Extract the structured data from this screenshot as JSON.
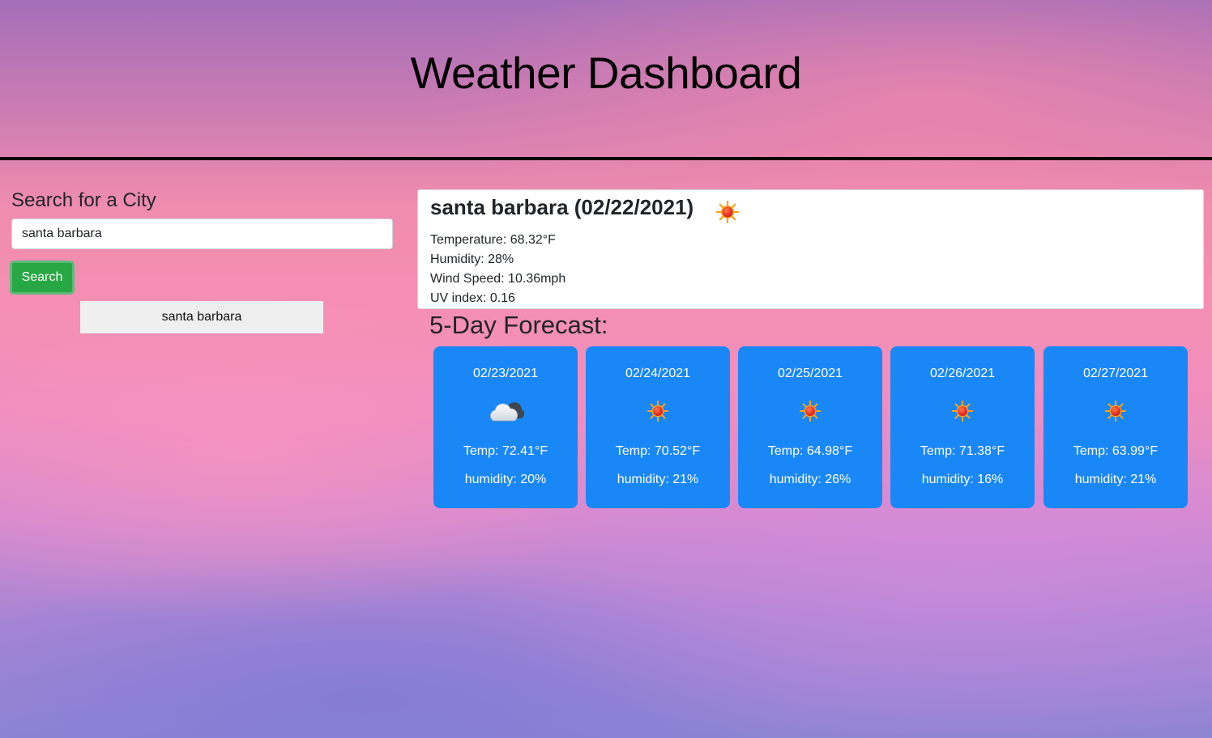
{
  "header": {
    "title": "Weather Dashboard"
  },
  "search": {
    "heading": "Search for a City",
    "input_value": "santa barbara",
    "button_label": "Search",
    "history": [
      "santa barbara"
    ]
  },
  "current": {
    "title": "santa barbara (02/22/2021)",
    "icon": "sun-icon",
    "temperature": "Temperature: 68.32°F",
    "humidity": "Humidity: 28%",
    "wind": "Wind Speed: 10.36mph",
    "uv": "UV index: 0.16"
  },
  "forecast": {
    "heading": "5-Day Forecast:",
    "days": [
      {
        "date": "02/23/2021",
        "icon": "cloud-icon",
        "temp": "Temp: 72.41°F",
        "humidity": "humidity: 20%"
      },
      {
        "date": "02/24/2021",
        "icon": "sun-icon",
        "temp": "Temp: 70.52°F",
        "humidity": "humidity: 21%"
      },
      {
        "date": "02/25/2021",
        "icon": "sun-icon",
        "temp": "Temp: 64.98°F",
        "humidity": "humidity: 26%"
      },
      {
        "date": "02/26/2021",
        "icon": "sun-icon",
        "temp": "Temp: 71.38°F",
        "humidity": "humidity: 16%"
      },
      {
        "date": "02/27/2021",
        "icon": "sun-icon",
        "temp": "Temp: 63.99°F",
        "humidity": "humidity: 21%"
      }
    ]
  },
  "colors": {
    "card": "#1a87f7",
    "search_button": "#28a745",
    "header_rule": "#000000"
  }
}
